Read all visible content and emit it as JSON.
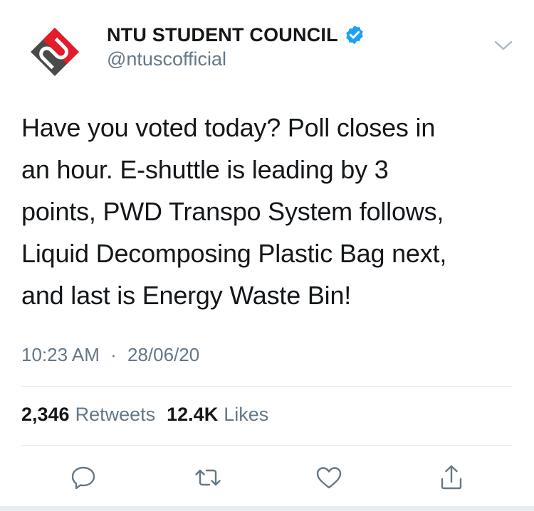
{
  "account": {
    "display_name": "NTU STUDENT COUNCIL",
    "handle": "@ntuscofficial",
    "verified": true,
    "avatar_icon": "ntu-logo",
    "brand_colors": {
      "red": "#e31b2a",
      "gray": "#4a4a4a"
    }
  },
  "tweet": {
    "text_lines": [
      "Have you voted today? Poll closes in",
      "an hour. E-shuttle is leading by 3",
      "points, PWD Transpo System follows,",
      "Liquid Decomposing Plastic Bag next,",
      "and last is Energy Waste Bin!"
    ],
    "time": "10:23 AM",
    "separator": "·",
    "date": "28/06/20"
  },
  "stats": {
    "retweets_count": "2,346",
    "retweets_label": "Retweets",
    "likes_count": "12.4K",
    "likes_label": "Likes"
  },
  "actions": [
    {
      "name": "reply",
      "icon": "reply-icon"
    },
    {
      "name": "retweet",
      "icon": "retweet-icon"
    },
    {
      "name": "like",
      "icon": "heart-icon"
    },
    {
      "name": "share",
      "icon": "share-icon"
    }
  ],
  "colors": {
    "text": "#14171a",
    "secondary": "#657786",
    "verified_blue": "#1da1f2",
    "divider": "#e1e8ed"
  }
}
